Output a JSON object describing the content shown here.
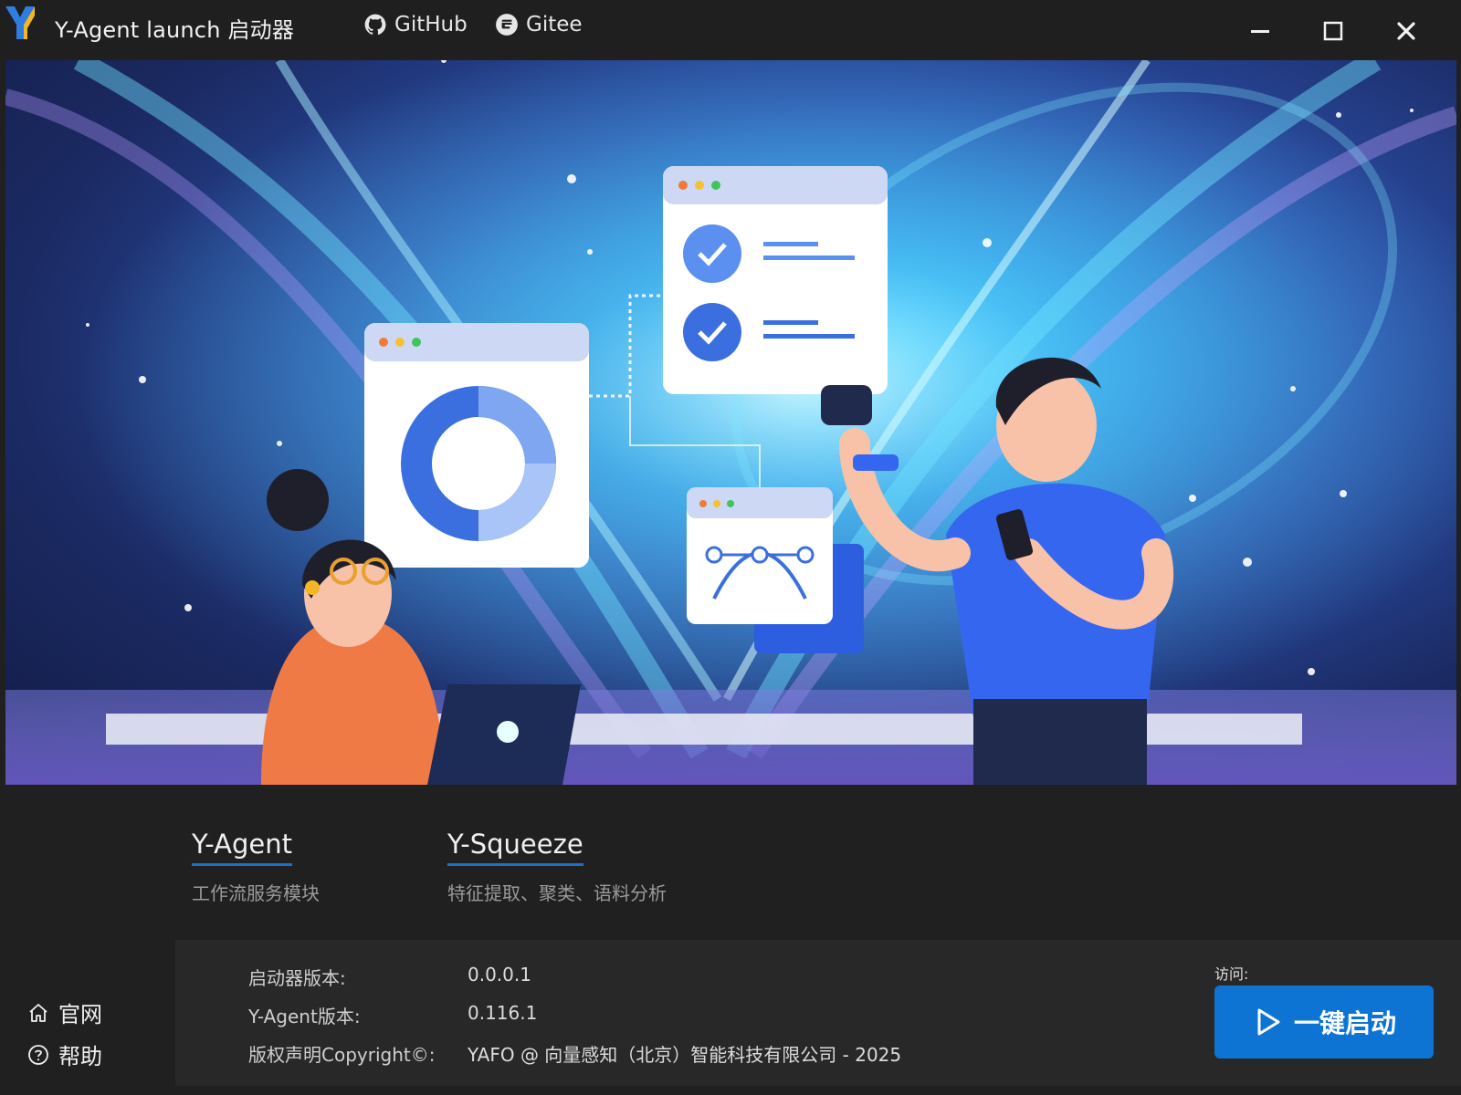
{
  "window": {
    "title": "Y-Agent launch 启动器",
    "links": [
      {
        "label": "GitHub",
        "icon": "github-icon"
      },
      {
        "label": "Gitee",
        "icon": "gitee-icon"
      }
    ]
  },
  "modules": [
    {
      "name": "Y-Agent",
      "desc": "工作流服务模块"
    },
    {
      "name": "Y-Squeeze",
      "desc": "特征提取、聚类、语料分析"
    }
  ],
  "sidebar": {
    "home_label": "官网",
    "help_label": "帮助"
  },
  "info": {
    "launcher_version_label": "启动器版本:",
    "launcher_version": "0.0.0.1",
    "agent_version_label": "Y-Agent版本:",
    "agent_version": "0.116.1",
    "copyright_label": "版权声明Copyright©:",
    "copyright_value": "YAFO @ 向量感知（北京）智能科技有限公司 - 2025"
  },
  "launch": {
    "visit_label": "访问:",
    "button_label": "一键启动"
  },
  "colors": {
    "accent": "#0d74d4",
    "background": "#202020",
    "panel": "#282828"
  }
}
